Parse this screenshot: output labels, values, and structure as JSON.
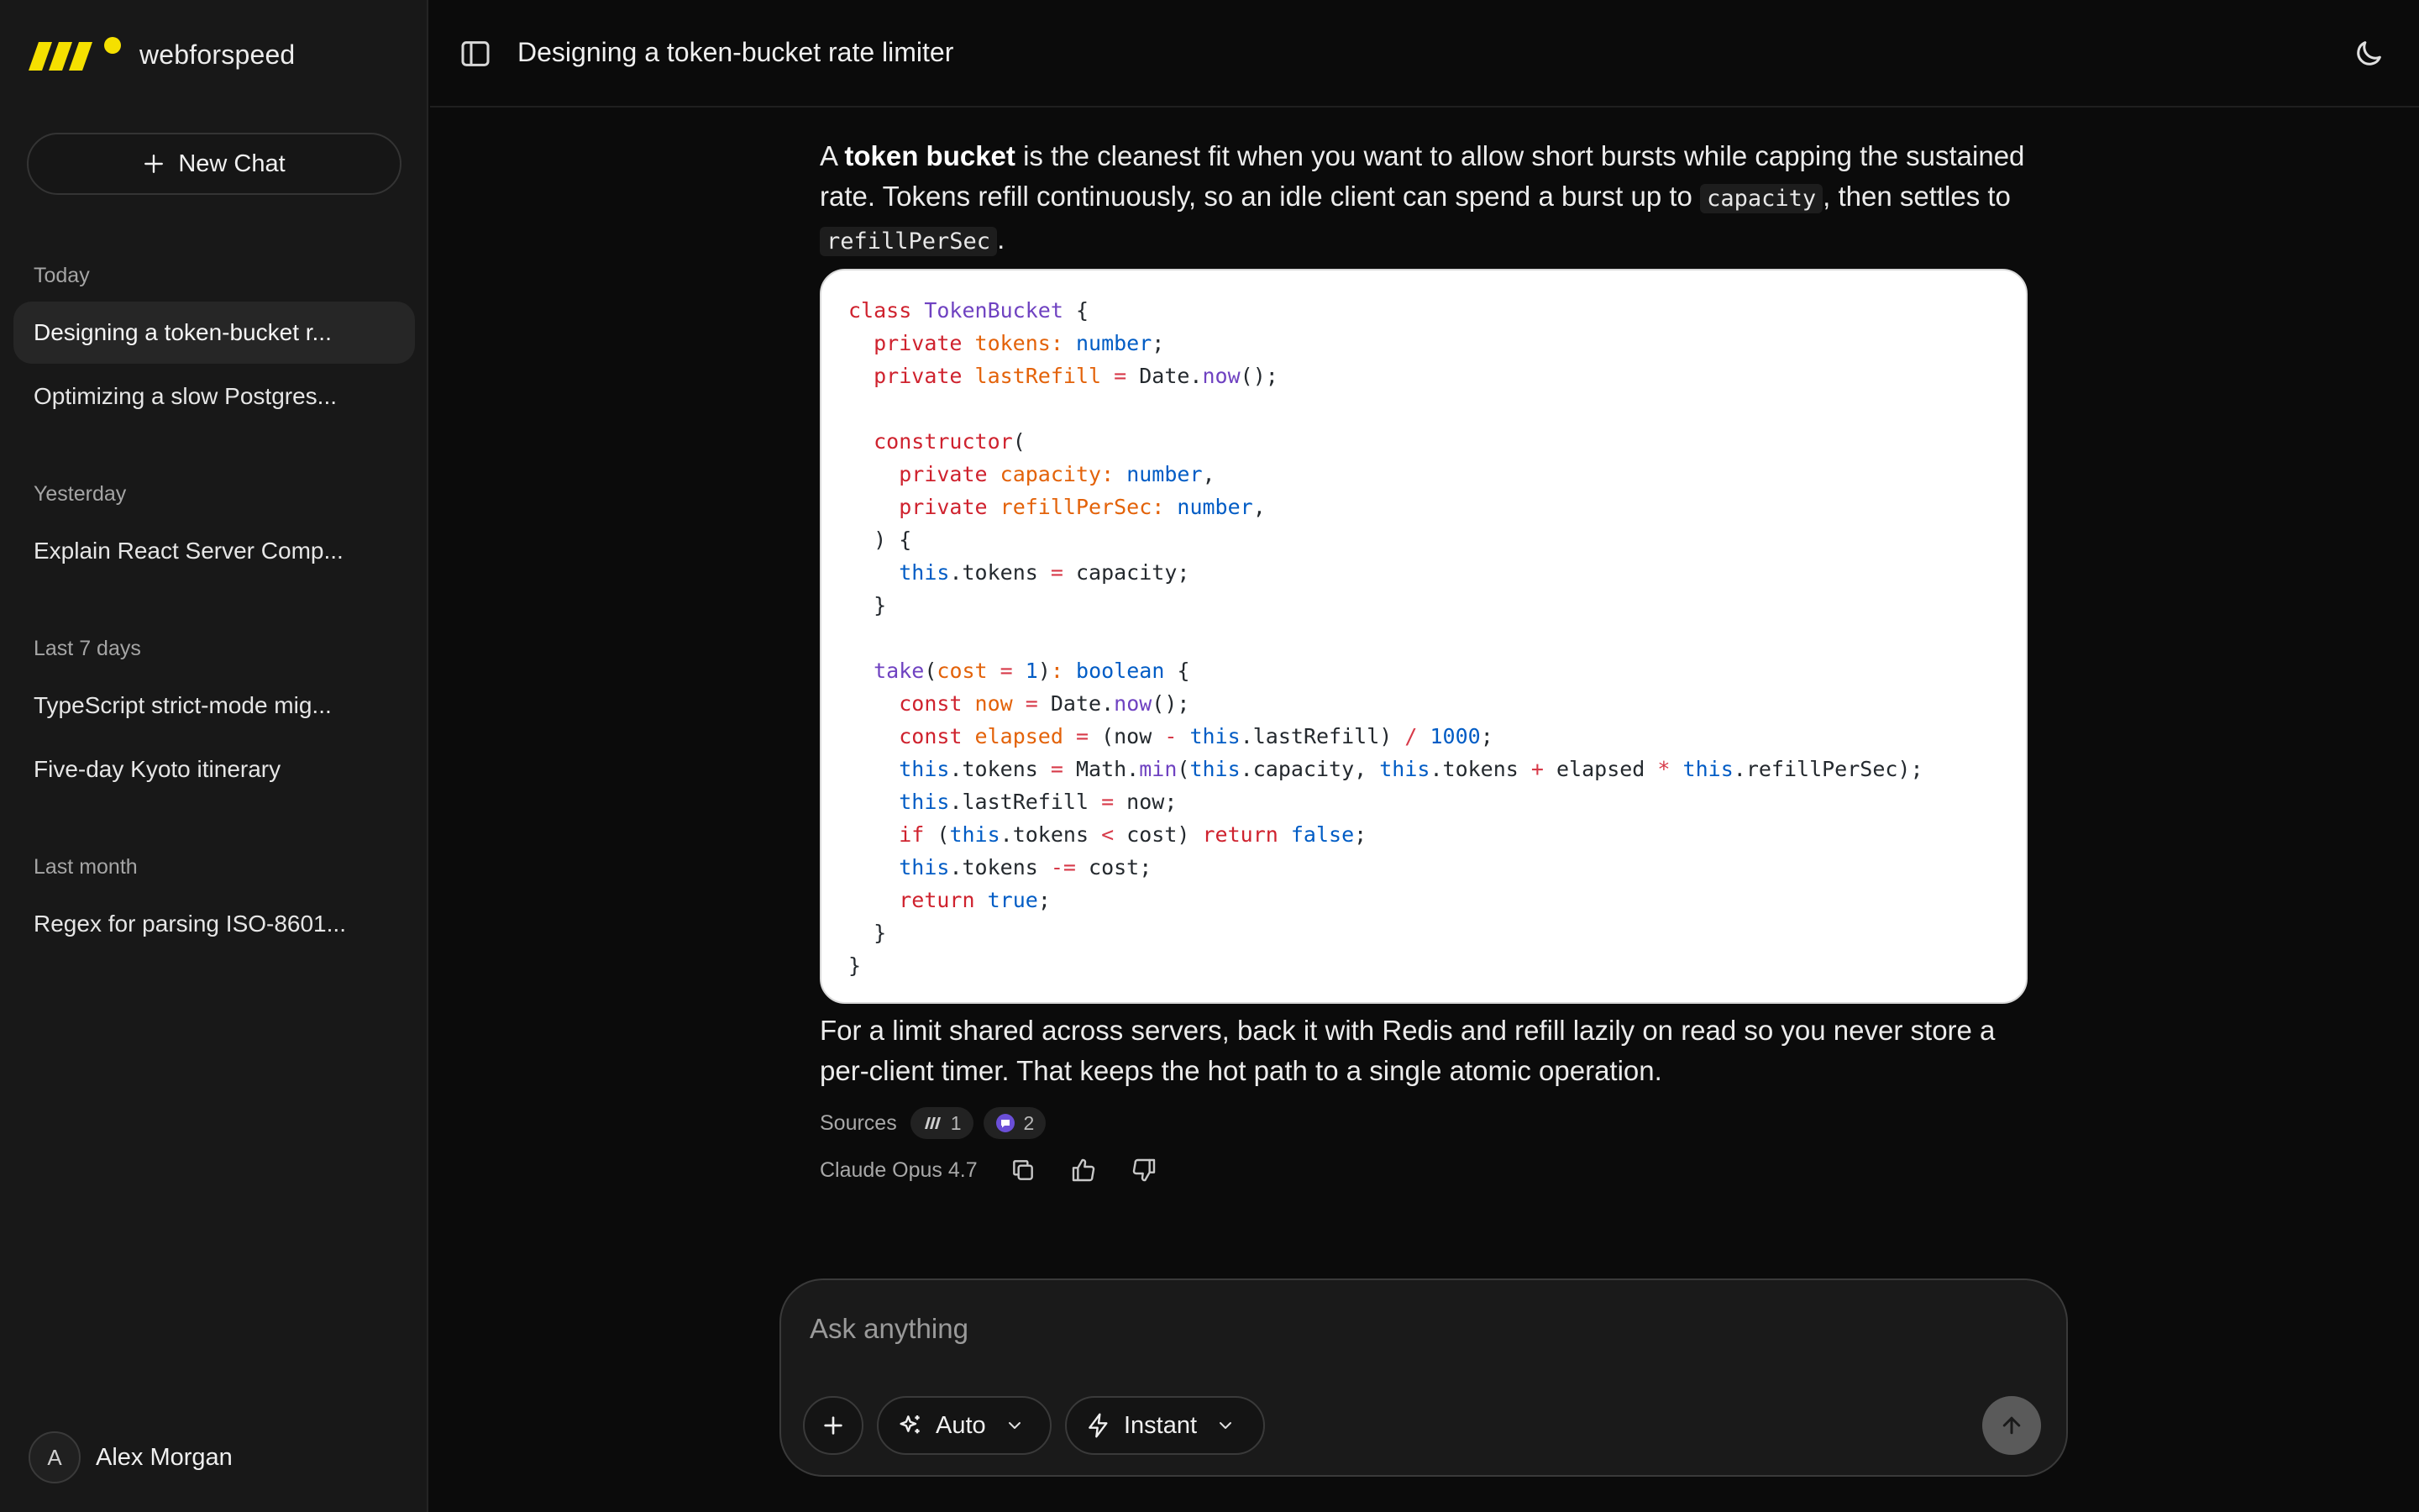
{
  "app": {
    "brand_name": "webforspeed",
    "brand_color": "#f5e000"
  },
  "sidebar": {
    "new_chat_label": "New Chat",
    "sections": [
      {
        "label": "Today",
        "items": [
          "Designing a token-bucket r...",
          "Optimizing a slow Postgres..."
        ]
      },
      {
        "label": "Yesterday",
        "items": [
          "Explain React Server Comp..."
        ]
      },
      {
        "label": "Last 7 days",
        "items": [
          "TypeScript strict-mode mig...",
          "Five-day Kyoto itinerary"
        ]
      },
      {
        "label": "Last month",
        "items": [
          "Regex for parsing ISO-8601..."
        ]
      }
    ],
    "user": {
      "initial": "A",
      "name": "Alex Morgan"
    }
  },
  "header": {
    "title": "Designing a token-bucket rate limiter"
  },
  "message": {
    "intro_a": "A ",
    "intro_bold": "token bucket",
    "intro_b": " is the cleanest fit when you want to allow short bursts while capping the sustained rate. Tokens refill continuously, so an idle client can spend a burst up to ",
    "intro_code1": "capacity",
    "intro_c": ", then settles to ",
    "intro_code2": "refillPerSec",
    "intro_d": ".",
    "outro": "For a limit shared across servers, back it with Redis and refill lazily on read so you never store a per-client timer. That keeps the hot path to a single atomic operation.",
    "sources_label": "Sources",
    "source_chips": [
      "1",
      "2"
    ],
    "model_label": "Claude Opus 4.7"
  },
  "code": {
    "language": "typescript",
    "lines": [
      "class TokenBucket {",
      "  private tokens: number;",
      "  private lastRefill = Date.now();",
      "",
      "  constructor(",
      "    private capacity: number,",
      "    private refillPerSec: number,",
      "  ) {",
      "    this.tokens = capacity;",
      "  }",
      "",
      "  take(cost = 1): boolean {",
      "    const now = Date.now();",
      "    const elapsed = (now - this.lastRefill) / 1000;",
      "    this.tokens = Math.min(this.capacity, this.tokens + elapsed * this.refillPerSec);",
      "    this.lastRefill = now;",
      "    if (this.tokens < cost) return false;",
      "    this.tokens -= cost;",
      "    return true;",
      "  }",
      "}"
    ]
  },
  "composer": {
    "placeholder": "Ask anything",
    "mode_label": "Auto",
    "speed_label": "Instant"
  }
}
